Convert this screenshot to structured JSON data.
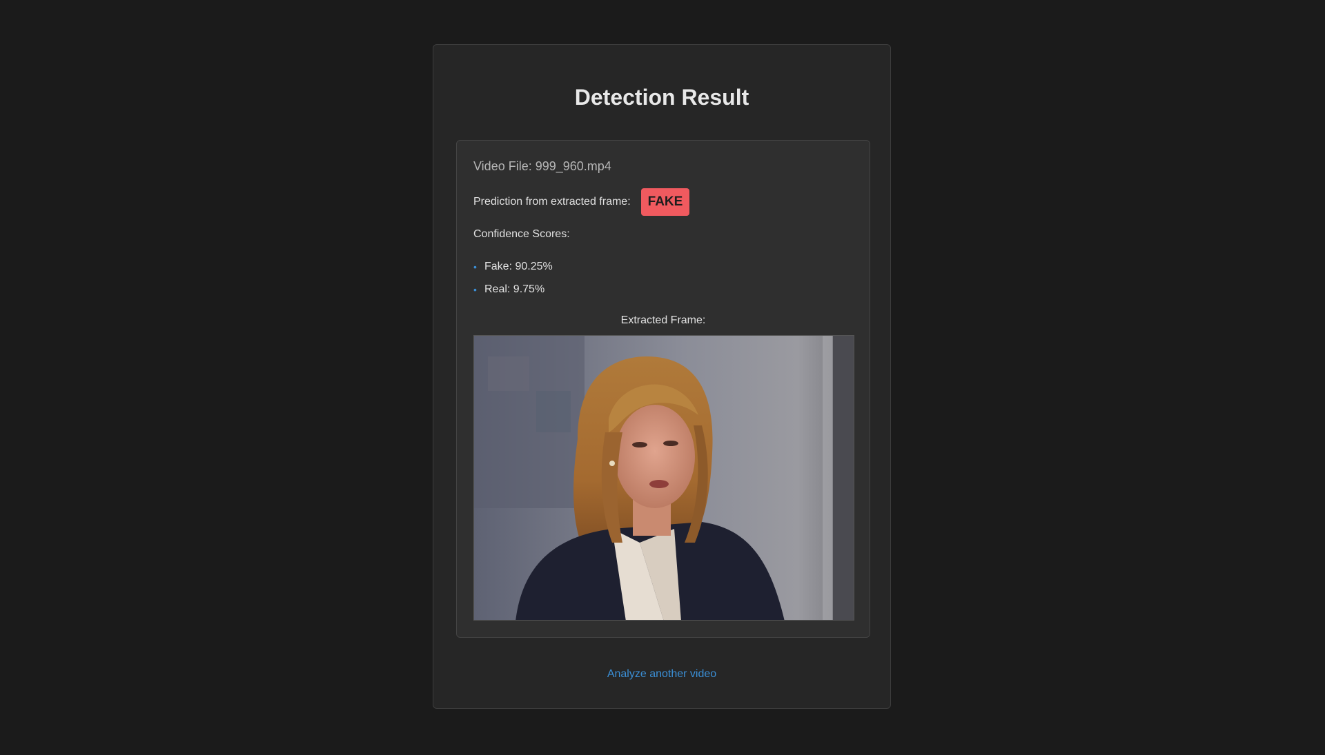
{
  "page": {
    "title": "Detection Result"
  },
  "result": {
    "video_file_label": "Video File: 999_960.mp4",
    "prediction_label": "Prediction from extracted frame:",
    "prediction_value": "FAKE",
    "prediction_color": "#f05a5f",
    "scores_heading": "Confidence Scores:",
    "scores": [
      {
        "text": "Fake: 90.25%"
      },
      {
        "text": "Real: 9.75%"
      }
    ],
    "frame_label": "Extracted Frame:"
  },
  "actions": {
    "analyze_another": "Analyze another video"
  },
  "theme": {
    "background": "#1b1b1b",
    "accent": "#3b8fd6"
  }
}
